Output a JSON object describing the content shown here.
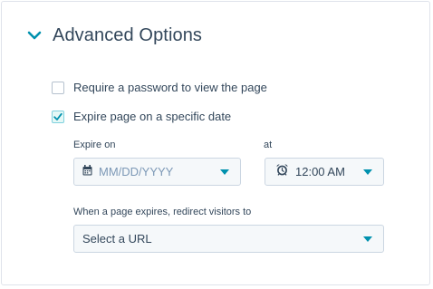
{
  "section": {
    "title": "Advanced Options",
    "expanded": true,
    "accent_color": "#0091ae"
  },
  "options": {
    "password": {
      "label": "Require a password to view the page",
      "checked": false
    },
    "expire": {
      "label": "Expire page on a specific date",
      "checked": true
    }
  },
  "expire_on": {
    "label": "Expire on",
    "placeholder": "MM/DD/YYYY",
    "icon": "calendar-icon"
  },
  "expire_at": {
    "label": "at",
    "value": "12:00 AM",
    "icon": "alarm-clock-icon"
  },
  "redirect": {
    "label": "When a page expires, redirect visitors to",
    "placeholder": "Select a URL"
  }
}
